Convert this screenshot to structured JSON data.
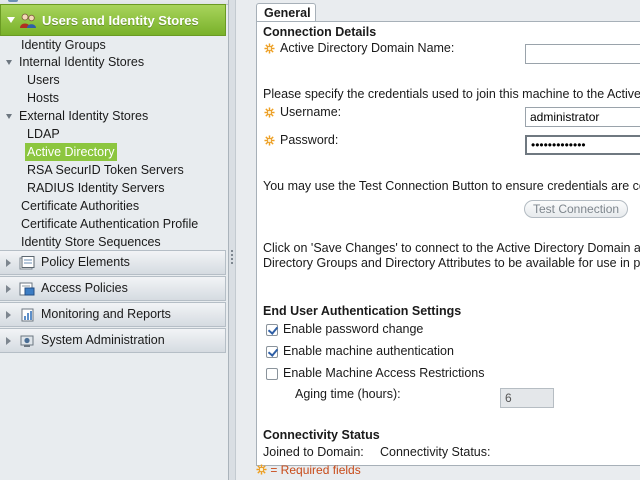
{
  "sidebar": {
    "active_drawer": "Users and Identity Stores",
    "tree": {
      "identity_groups": "Identity Groups",
      "internal_identity_stores": "Internal Identity Stores",
      "users": "Users",
      "hosts": "Hosts",
      "external_identity_stores": "External Identity Stores",
      "ldap": "LDAP",
      "active_directory": "Active Directory",
      "rsa_securid": "RSA SecurID Token Servers",
      "radius": "RADIUS Identity Servers",
      "certificate_authorities": "Certificate Authorities",
      "certificate_authentication_profile": "Certificate Authentication Profile",
      "identity_store_sequences": "Identity Store Sequences"
    },
    "drawers": {
      "policy_elements": "Policy Elements",
      "access_policies": "Access Policies",
      "monitoring_and_reports": "Monitoring and Reports",
      "system_administration": "System Administration"
    }
  },
  "main": {
    "tab": "General",
    "connection_details": {
      "heading": "Connection Details",
      "domain_label": "Active Directory Domain Name:",
      "domain_value": "",
      "credentials_text": "Please specify the credentials used to join this machine to the Active D",
      "username_label": "Username:",
      "username_value": "administrator",
      "password_label": "Password:",
      "password_value": "•••••••••••••",
      "test_text": "You may use the Test Connection Button to ensure credentials are co",
      "test_button": "Test Connection",
      "save_text_1": "Click on 'Save Changes' to connect to the Active Directory Domain an",
      "save_text_2": "Directory Groups and Directory Attributes to be available for use in po"
    },
    "end_user_auth": {
      "heading": "End User Authentication Settings",
      "enable_password_change": "Enable password change",
      "enable_password_change_checked": true,
      "enable_machine_auth": "Enable machine authentication",
      "enable_machine_auth_checked": true,
      "enable_machine_access": "Enable Machine Access Restrictions",
      "enable_machine_access_checked": false,
      "aging_label": "Aging time (hours):",
      "aging_value": "6"
    },
    "connectivity": {
      "heading": "Connectivity Status",
      "joined_label": "Joined to Domain:",
      "status_label": "Connectivity Status:"
    },
    "footer": "= Required fields"
  },
  "colors": {
    "accent_green": "#8cc63f",
    "required_orange": "#f0a020",
    "footer_text": "#c84a18"
  },
  "icons": [
    "users-icon",
    "policy-elements-icon",
    "access-policies-icon",
    "monitoring-icon",
    "system-administration-icon",
    "required-star-icon",
    "checkmark-icon"
  ]
}
